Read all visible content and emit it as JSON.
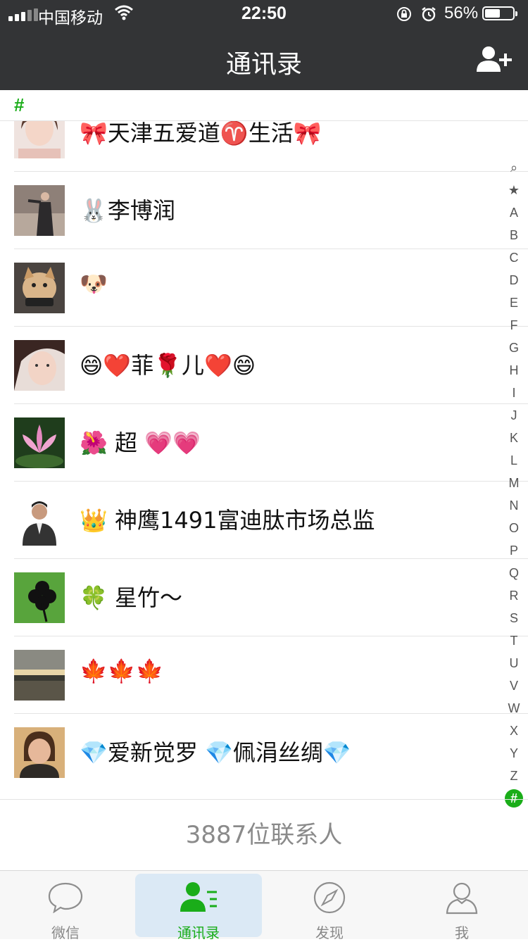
{
  "status_bar": {
    "carrier": "中国移动",
    "time": "22:50",
    "battery_percent": "56%",
    "battery_level": 0.56
  },
  "nav": {
    "title": "通讯录",
    "add_icon": "add-contact-icon"
  },
  "section": {
    "letter": "#"
  },
  "contacts": [
    {
      "name": "🎀天津五爱道♈️生活🎀",
      "avatar_color": "#e9d2cc"
    },
    {
      "name": "🐰李博润",
      "avatar_color": "#8a7a72"
    },
    {
      "name": "🐶",
      "avatar_color": "#b89a70"
    },
    {
      "name": "😄❤️菲🌹儿❤️😄",
      "avatar_color": "#e6c8bd"
    },
    {
      "name": "🌺 超 💗💗",
      "avatar_color": "#2e5a2a"
    },
    {
      "name": "👑 神鹰1491富迪肽市场总监",
      "avatar_color": "#f2f2f2"
    },
    {
      "name": "🍀 星竹～",
      "avatar_color": "#3f8a2c"
    },
    {
      "name": "🍁🍁🍁",
      "avatar_color": "#6e6a5e"
    },
    {
      "name": "💎爱新觉罗 💎佩涓丝绸💎",
      "avatar_color": "#c99a5a"
    }
  ],
  "index_bar": {
    "items": [
      "⌕",
      "★",
      "A",
      "B",
      "C",
      "D",
      "E",
      "F",
      "G",
      "H",
      "I",
      "J",
      "K",
      "L",
      "M",
      "N",
      "O",
      "P",
      "Q",
      "R",
      "S",
      "T",
      "U",
      "V",
      "W",
      "X",
      "Y",
      "Z",
      "#"
    ],
    "active": "#"
  },
  "footer": {
    "count_text": "3887位联系人"
  },
  "tabs": [
    {
      "label": "微信",
      "icon": "chat-bubble-icon",
      "active": false
    },
    {
      "label": "通讯录",
      "icon": "contacts-icon",
      "active": true
    },
    {
      "label": "发现",
      "icon": "compass-icon",
      "active": false
    },
    {
      "label": "我",
      "icon": "person-icon",
      "active": false
    }
  ],
  "colors": {
    "accent": "#1aad19",
    "nav_bg": "#333436",
    "tab_highlight": "#dbe9f5"
  }
}
